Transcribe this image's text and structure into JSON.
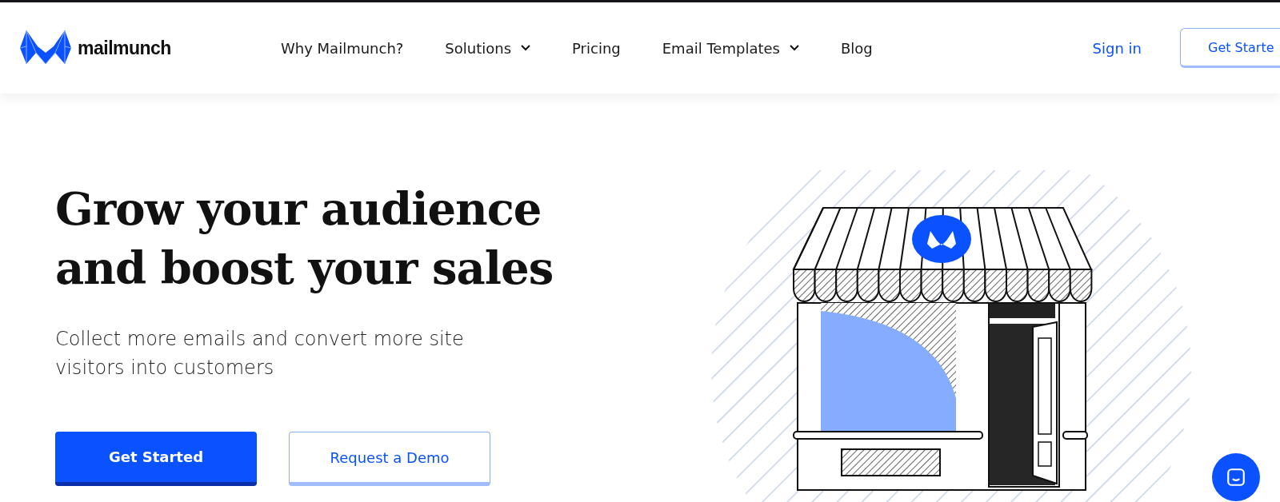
{
  "header": {
    "logo_text": "mailmunch",
    "nav": [
      {
        "label": "Why Mailmunch?",
        "dropdown": false
      },
      {
        "label": "Solutions",
        "dropdown": true
      },
      {
        "label": "Pricing",
        "dropdown": false
      },
      {
        "label": "Email Templates",
        "dropdown": true
      },
      {
        "label": "Blog",
        "dropdown": false
      }
    ],
    "sign_in": "Sign in",
    "cta": "Get Starte"
  },
  "hero": {
    "title": "Grow your audience and boost your sales",
    "subtitle": "Collect more emails and convert more site visitors into customers",
    "buttons": [
      {
        "label": "Get Started",
        "kind": "primary"
      },
      {
        "label": "Request a Demo",
        "kind": "secondary"
      }
    ]
  }
}
